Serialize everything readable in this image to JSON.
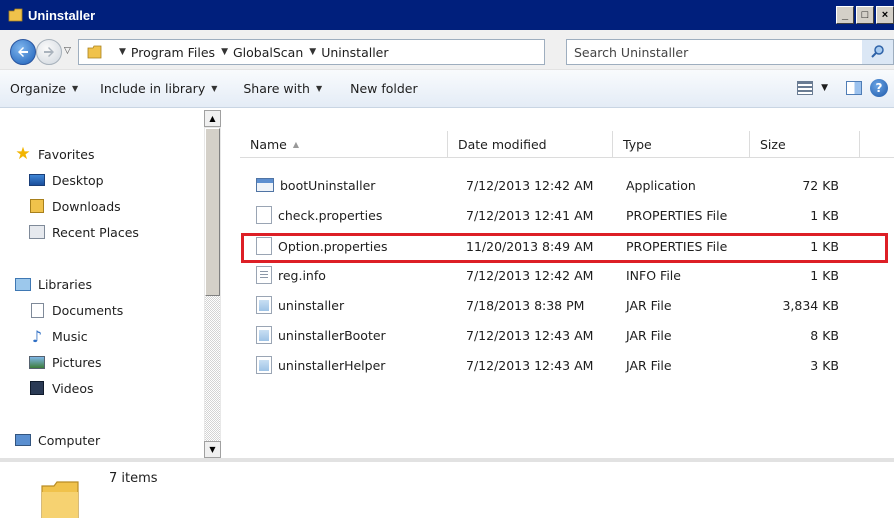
{
  "window": {
    "title": "Uninstaller",
    "buttons": [
      "_",
      "□",
      "×"
    ]
  },
  "address": {
    "crumbs": [
      "Program Files",
      "GlobalScan",
      "Uninstaller"
    ],
    "search_placeholder": "Search Uninstaller"
  },
  "toolbar": {
    "organize": "Organize",
    "include_in_library": "Include in library",
    "share_with": "Share with",
    "new_folder": "New folder"
  },
  "nav": {
    "favorites": "Favorites",
    "desktop": "Desktop",
    "downloads": "Downloads",
    "recent_places": "Recent Places",
    "libraries": "Libraries",
    "documents": "Documents",
    "music": "Music",
    "pictures": "Pictures",
    "videos": "Videos",
    "computer": "Computer"
  },
  "columns": {
    "name": "Name",
    "date": "Date modified",
    "type": "Type",
    "size": "Size"
  },
  "files": [
    {
      "name": "bootUninstaller",
      "date": "7/12/2013 12:42 AM",
      "type": "Application",
      "size": "72 KB",
      "icon": "app"
    },
    {
      "name": "check.properties",
      "date": "7/12/2013 12:41 AM",
      "type": "PROPERTIES File",
      "size": "1 KB",
      "icon": "file"
    },
    {
      "name": "Option.properties",
      "date": "11/20/2013 8:49 AM",
      "type": "PROPERTIES File",
      "size": "1 KB",
      "icon": "file"
    },
    {
      "name": "reg.info",
      "date": "7/12/2013 12:42 AM",
      "type": "INFO File",
      "size": "1 KB",
      "icon": "info"
    },
    {
      "name": "uninstaller",
      "date": "7/18/2013 8:38 PM",
      "type": "JAR File",
      "size": "3,834 KB",
      "icon": "jar"
    },
    {
      "name": "uninstallerBooter",
      "date": "7/12/2013 12:43 AM",
      "type": "JAR File",
      "size": "8 KB",
      "icon": "jar"
    },
    {
      "name": "uninstallerHelper",
      "date": "7/12/2013 12:43 AM",
      "type": "JAR File",
      "size": "3 KB",
      "icon": "jar"
    }
  ],
  "status": {
    "item_count": "7 items"
  },
  "colors": {
    "titlebar": "#001f7c",
    "highlight": "#dd1f26"
  }
}
